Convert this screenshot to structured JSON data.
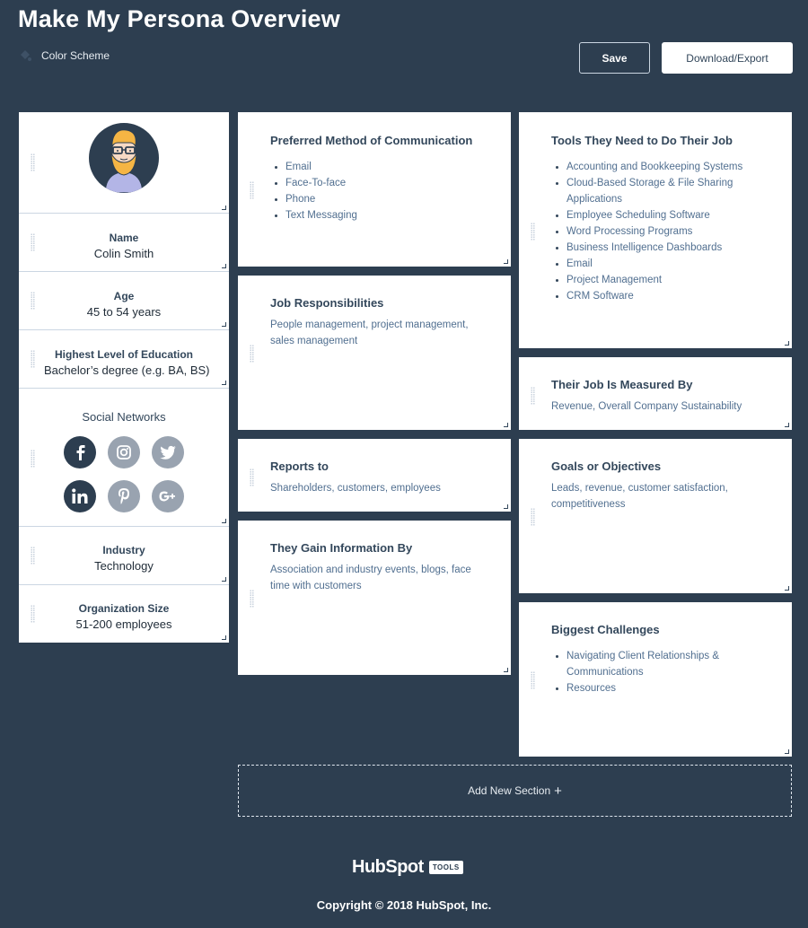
{
  "header": {
    "title": "Make My Persona Overview",
    "color_scheme_label": "Color Scheme",
    "save_label": "Save",
    "export_label": "Download/Export"
  },
  "profile": {
    "avatar_alt": "Bearded man with glasses avatar",
    "fields": [
      {
        "label": "Name",
        "value": "Colin Smith"
      },
      {
        "label": "Age",
        "value": "45 to 54 years"
      },
      {
        "label": "Highest Level of Education",
        "value": "Bachelor’s degree (e.g. BA, BS)"
      },
      {
        "label": "Industry",
        "value": "Technology"
      },
      {
        "label": "Organization Size",
        "value": "51-200 employees"
      }
    ],
    "social": {
      "label": "Social Networks",
      "networks": [
        {
          "name": "facebook",
          "active": true
        },
        {
          "name": "instagram",
          "active": false
        },
        {
          "name": "twitter",
          "active": false
        },
        {
          "name": "linkedin",
          "active": true
        },
        {
          "name": "pinterest",
          "active": false
        },
        {
          "name": "google-plus",
          "active": false
        }
      ]
    }
  },
  "sections": {
    "communication": {
      "title": "Preferred Method of Communication",
      "items": [
        "Email",
        "Face-To-face",
        "Phone",
        "Text Messaging"
      ]
    },
    "responsibilities": {
      "title": "Job Responsibilities",
      "text": "People management, project management, sales management"
    },
    "reports_to": {
      "title": "Reports to",
      "text": "Shareholders, customers, employees"
    },
    "gain_info": {
      "title": "They Gain Information By",
      "text": "Association and industry events, blogs, face time with customers"
    },
    "tools": {
      "title": "Tools They Need to Do Their Job",
      "items": [
        "Accounting and Bookkeeping Systems",
        "Cloud-Based Storage & File Sharing Applications",
        "Employee Scheduling Software",
        "Word Processing Programs",
        "Business Intelligence Dashboards",
        "Email",
        "Project Management",
        "CRM Software"
      ]
    },
    "measured_by": {
      "title": "Their Job Is Measured By",
      "text": "Revenue, Overall Company Sustainability"
    },
    "goals": {
      "title": "Goals or Objectives",
      "text": "Leads, revenue, customer satisfaction, competitiveness"
    },
    "challenges": {
      "title": "Biggest Challenges",
      "items": [
        "Navigating Client Relationships & Communications",
        "Resources"
      ]
    }
  },
  "add_section_label": "Add New Section",
  "add_section_icon": "+",
  "footer": {
    "brand": "HubSpot",
    "badge": "TOOLS",
    "copyright": "Copyright © 2018 HubSpot, Inc."
  },
  "colors": {
    "background": "#2d3e50",
    "card": "#ffffff",
    "text_dark": "#33475b",
    "text_muted": "#516f90",
    "social_active": "#2d3e50",
    "social_inactive": "#99a3b0"
  }
}
